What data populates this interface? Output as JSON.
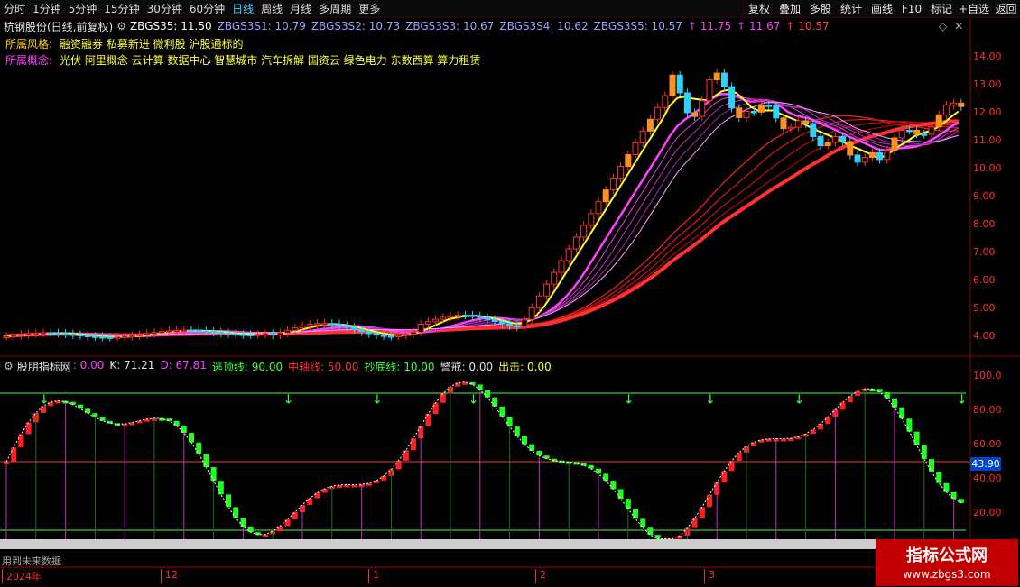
{
  "toolbar": {
    "periods": [
      {
        "label": "分时",
        "active": false
      },
      {
        "label": "1分钟",
        "active": false
      },
      {
        "label": "5分钟",
        "active": false
      },
      {
        "label": "15分钟",
        "active": false
      },
      {
        "label": "30分钟",
        "active": false
      },
      {
        "label": "60分钟",
        "active": false
      },
      {
        "label": "日线",
        "active": true
      },
      {
        "label": "周线",
        "active": false
      },
      {
        "label": "月线",
        "active": false
      },
      {
        "label": "多周期",
        "active": false
      },
      {
        "label": "更多",
        "active": false
      }
    ],
    "right_buttons": [
      "复权",
      "叠加",
      "多股",
      "统计",
      "画线",
      "F10",
      "标记",
      "+自选",
      "返回"
    ]
  },
  "header": {
    "stock": "杭钢股份(日线,前复权)",
    "ma": [
      {
        "label": "ZBGS35: 11.50",
        "color": "#ffffff"
      },
      {
        "label": "ZBGS3S1: 10.79",
        "color": "#a0a0ff"
      },
      {
        "label": "ZBGS3S2: 10.73",
        "color": "#a0a0ff"
      },
      {
        "label": "ZBGS3S3: 10.67",
        "color": "#a0a0ff"
      },
      {
        "label": "ZBGS3S4: 10.62",
        "color": "#a0a0ff"
      },
      {
        "label": "ZBGS3S5: 10.57",
        "color": "#a0a0ff"
      },
      {
        "label": "↑ 11.75",
        "color": "#ff40ff"
      },
      {
        "label": "↑ 11.67",
        "color": "#ff40ff"
      },
      {
        "label": "↑ 10.57",
        "color": "#ff4040"
      }
    ],
    "style_key": "所属风格:",
    "style_value": "融资融券 私募新进 微利股 沪股通标的",
    "concept_key": "所属概念:",
    "concept_value": "光伏 阿里概念 云计算 数据中心 智慧城市 汽车拆解 国资云 绿色电力 东数西算 算力租赁"
  },
  "price_axis": [
    "14.00",
    "13.00",
    "12.00",
    "11.00",
    "10.00",
    "9.00",
    "8.00",
    "7.00",
    "6.00",
    "5.00",
    "4.00"
  ],
  "indicator": {
    "name": "股朋指标网",
    "fields": [
      {
        "label": ": 0.00",
        "color": "#ff40ff"
      },
      {
        "label": "K: 71.21",
        "color": "#e0e0e0"
      },
      {
        "label": "D: 67.81",
        "color": "#ff40ff"
      },
      {
        "label": "逃顶线: 90.00",
        "color": "#40ff40"
      },
      {
        "label": "中轴线: 50.00",
        "color": "#ff3030"
      },
      {
        "label": "抄底线: 10.00",
        "color": "#40ff40"
      },
      {
        "label": "警戒: 0.00",
        "color": "#e0e0e0"
      },
      {
        "label": "出击: 0.00",
        "color": "#ffff40"
      }
    ],
    "axis": [
      "100.0",
      "80.00",
      "60.00",
      "40.00",
      "20.00"
    ],
    "current": "43.90"
  },
  "future_note": "用到未来数据",
  "dates": [
    {
      "label": "2024年"
    },
    {
      "label": "12"
    },
    {
      "label": "1"
    },
    {
      "label": "2"
    },
    {
      "label": "3"
    }
  ],
  "watermark": {
    "line1": "指标公式网",
    "line2": "www.zbgs3.com"
  }
}
